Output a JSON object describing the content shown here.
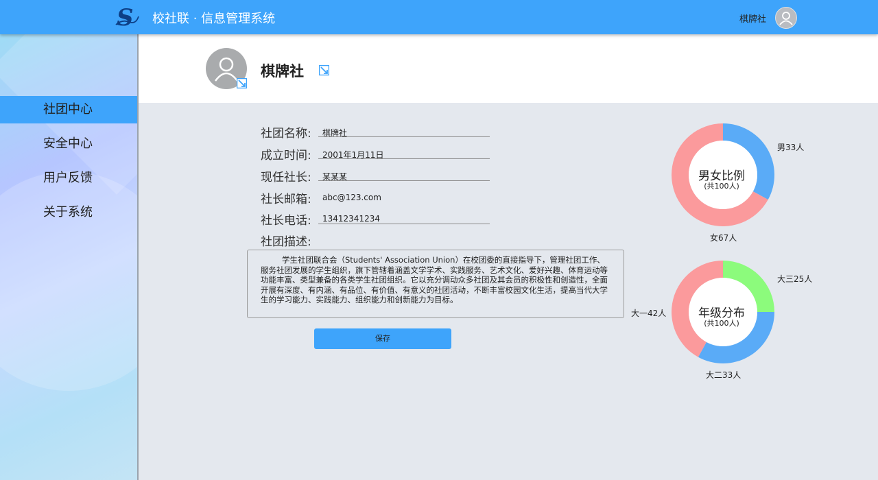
{
  "header": {
    "app_title": "校社联 · 信息管理系统",
    "user_name": "棋牌社"
  },
  "sidebar": {
    "items": [
      {
        "label": "社团中心",
        "active": true
      },
      {
        "label": "安全中心",
        "active": false
      },
      {
        "label": "用户反馈",
        "active": false
      },
      {
        "label": "关于系统",
        "active": false
      }
    ]
  },
  "profile": {
    "club_name": "棋牌社"
  },
  "form": {
    "name_label": "社团名称:",
    "name_value": "棋牌社",
    "founded_label": "成立时间:",
    "founded_value": "2001年1月11日",
    "president_label": "现任社长:",
    "president_value": "某某某",
    "email_label": "社长邮箱:",
    "email_value": "abc@123.com",
    "phone_label": "社长电话:",
    "phone_value": "13412341234",
    "desc_label": "社团描述:",
    "desc_value": "学生社团联合会（Students' Association Union）在校团委的直接指导下，管理社团工作、服务社团发展的学生组织，旗下管辖着涵盖文学学术、实践服务、艺术文化、爱好兴趣、体育运动等功能丰富、类型兼备的各类学生社团组织。它以充分调动众多社团及其会员的积极性和创造性，全面开展有深度、有内涵、有品位、有价值、有意义的社团活动，不断丰富校园文化生活，提高当代大学生的学习能力、实践能力、组织能力和创新能力为目标。",
    "save_label": "保存"
  },
  "colors": {
    "accent": "#3ea4fb",
    "male": "#5aabf7",
    "female": "#fb9a9c",
    "year3": "#8cfb7c",
    "year2": "#5aabf7",
    "year1": "#fb9a9c"
  },
  "chart_data": [
    {
      "type": "pie",
      "title": "男女比例",
      "subtitle": "(共100人)",
      "categories": [
        "男",
        "女"
      ],
      "values": [
        33,
        67
      ],
      "labels": [
        "男33人",
        "女67人"
      ],
      "colors": [
        "#5aabf7",
        "#fb9a9c"
      ]
    },
    {
      "type": "pie",
      "title": "年级分布",
      "subtitle": "(共100人)",
      "categories": [
        "大三",
        "大二",
        "大一"
      ],
      "values": [
        25,
        33,
        42
      ],
      "labels": [
        "大三25人",
        "大二33人",
        "大一42人"
      ],
      "colors": [
        "#8cfb7c",
        "#5aabf7",
        "#fb9a9c"
      ]
    }
  ]
}
